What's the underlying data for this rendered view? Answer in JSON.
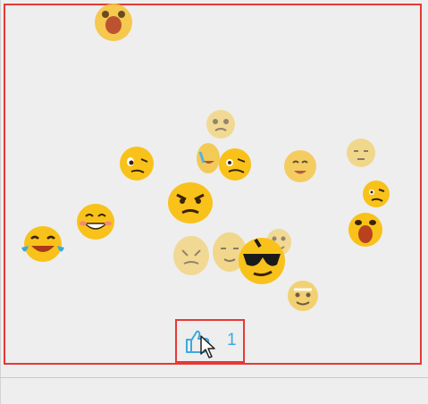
{
  "colors": {
    "frame_border": "#e53935",
    "background": "#eeeeee",
    "like_accent": "#3aa9e0",
    "emoji_yellow": "#f9c21a"
  },
  "like_button": {
    "icon": "thumbs-up-icon",
    "count": "1"
  },
  "floating_emojis": [
    "shocked-face-icon",
    "confused-face-icon",
    "smirking-face-icon",
    "laughing-tears-face-icon",
    "grinning-face-icon",
    "angry-face-icon",
    "tongue-face-icon",
    "sunglasses-face-icon",
    "crying-face-icon",
    "sleepy-face-icon"
  ],
  "cursor": "arrow-cursor-icon"
}
